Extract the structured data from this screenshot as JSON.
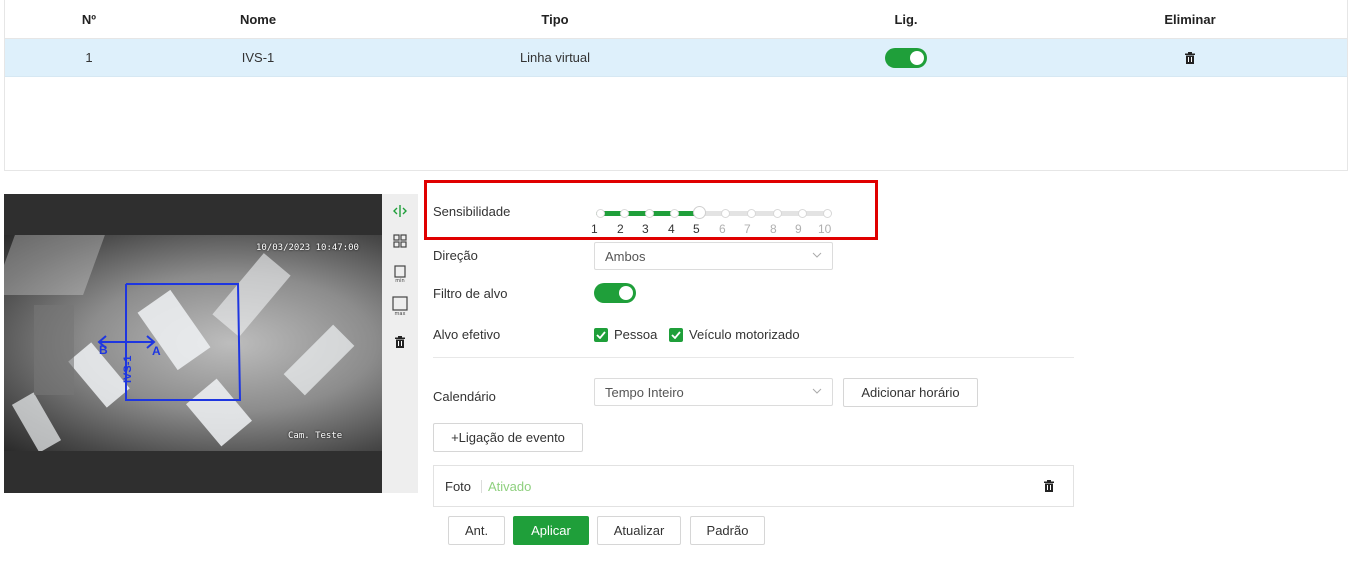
{
  "rules_table": {
    "columns": [
      "Nº",
      "Nome",
      "Tipo",
      "Lig.",
      "Eliminar"
    ],
    "rows": [
      {
        "no": "1",
        "nome": "IVS-1",
        "tipo": "Linha virtual",
        "enabled": true
      }
    ]
  },
  "video": {
    "timestamp_osd": "10/03/2023 10:47:00",
    "camera_osd": "Cam. Teste",
    "rule_label": "IVS-1",
    "point_a": "A",
    "point_b": "B"
  },
  "toolbar_icons": [
    "line-draw-icon",
    "target-filter-icon",
    "min-size-icon",
    "max-size-icon",
    "trash-icon"
  ],
  "form": {
    "sensibilidade": {
      "label": "Sensibilidade",
      "ticks": [
        "1",
        "2",
        "3",
        "4",
        "5",
        "6",
        "7",
        "8",
        "9",
        "10"
      ],
      "value": 5
    },
    "direcao": {
      "label": "Direção",
      "value": "Ambos"
    },
    "filtro_alvo": {
      "label": "Filtro de alvo",
      "enabled": true
    },
    "alvo_efetivo": {
      "label": "Alvo efetivo",
      "options": [
        {
          "label": "Pessoa",
          "checked": true
        },
        {
          "label": "Veículo motorizado",
          "checked": true
        }
      ]
    },
    "calendario": {
      "label": "Calendário",
      "value": "Tempo Inteiro",
      "add_button": "Adicionar horário"
    },
    "event_link_button": "+Ligação de evento",
    "foto": {
      "label": "Foto",
      "status": "Ativado"
    }
  },
  "actions": {
    "prev": "Ant.",
    "apply": "Aplicar",
    "refresh": "Atualizar",
    "default": "Padrão"
  },
  "colors": {
    "accent": "#1f9f3a",
    "selected_row": "#def0fb",
    "highlight_box": "#e00000",
    "overlay_line": "#1e36e0",
    "status_text": "#8fd07f"
  }
}
